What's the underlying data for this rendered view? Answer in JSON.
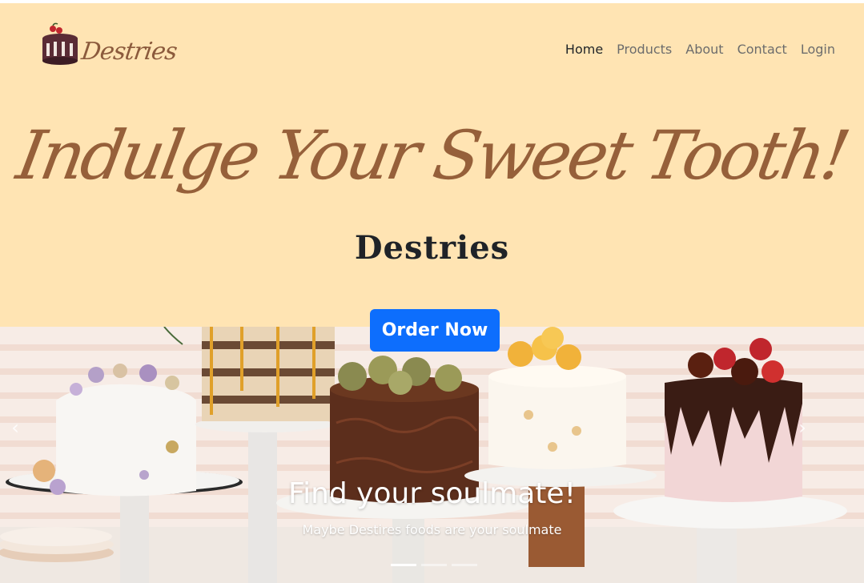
{
  "navbar": {
    "brand_text": "Destries",
    "brand_icon": "cake-icon",
    "links": [
      {
        "label": "Home",
        "active": true
      },
      {
        "label": "Products",
        "active": false
      },
      {
        "label": "About",
        "active": false
      },
      {
        "label": "Contact",
        "active": false
      },
      {
        "label": "Login",
        "active": false
      }
    ]
  },
  "hero": {
    "tagline": "Indulge Your Sweet Tooth!",
    "site_name": "Destries",
    "order_button": "Order Now"
  },
  "carousel": {
    "caption_title": "Find your soulmate!",
    "caption_subtitle": "Maybe Destires foods are your soulmate",
    "slide_count": 3,
    "active_slide": 1,
    "prev_icon": "chevron-left-icon",
    "next_icon": "chevron-right-icon"
  },
  "colors": {
    "hero_bg": "#ffe4b3",
    "tagline": "#96603a",
    "button": "#0d6efd"
  }
}
